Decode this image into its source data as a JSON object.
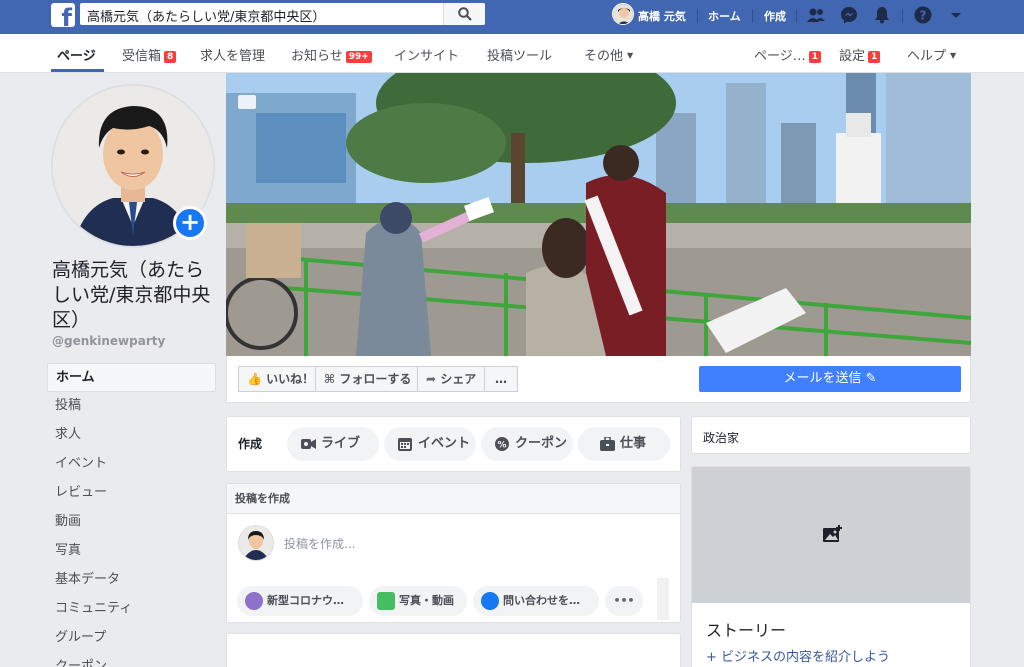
{
  "topbar": {
    "search_value": "高橋元気（あたらしい党/東京都中央区）",
    "user_name": "高橋 元気",
    "home": "ホーム",
    "create": "作成"
  },
  "pagenav": {
    "tabs": [
      {
        "label": "ページ",
        "badge": ""
      },
      {
        "label": "受信箱",
        "badge": "8"
      },
      {
        "label": "求人を管理",
        "badge": ""
      },
      {
        "label": "お知らせ",
        "badge": "99+"
      },
      {
        "label": "インサイト",
        "badge": ""
      },
      {
        "label": "投稿ツール",
        "badge": ""
      },
      {
        "label": "その他",
        "badge": ""
      }
    ],
    "right": [
      {
        "label": "ページ…",
        "badge": "1"
      },
      {
        "label": "設定",
        "badge": "1"
      },
      {
        "label": "ヘルプ",
        "badge": ""
      }
    ]
  },
  "page": {
    "name": "高橋元気（あたらしい党/東京都中央区）",
    "handle": "@genkinewparty"
  },
  "leftmenu": [
    "ホーム",
    "投稿",
    "求人",
    "イベント",
    "レビュー",
    "動画",
    "写真",
    "基本データ",
    "コミュニティ",
    "グループ",
    "クーポン"
  ],
  "actions": {
    "like": "いいね！",
    "follow": "フォローする",
    "share": "シェア",
    "more": "…",
    "send_message": "メールを送信"
  },
  "composer": {
    "create_label": "作成",
    "pills": [
      "ライブ",
      "イベント",
      "クーポン",
      "仕事"
    ],
    "post_header": "投稿を作成",
    "placeholder": "投稿を作成...",
    "chips": [
      "新型コロナウ…",
      "写真・動画",
      "問い合わせを…"
    ],
    "more": "•••"
  },
  "right": {
    "category": "政治家",
    "story_title": "ストーリー",
    "story_link": "+ ビジネスの内容を紹介しよう"
  },
  "colors": {
    "fb_blue": "#4267b2",
    "send_blue": "#4080ff",
    "badge_red": "#fa3e3e",
    "page_bg": "#e9ebee"
  }
}
